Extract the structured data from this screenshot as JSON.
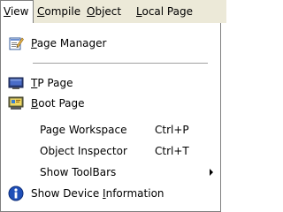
{
  "menubar": {
    "items": [
      {
        "before": "",
        "mnemonic": "V",
        "after": "iew"
      },
      {
        "before": "",
        "mnemonic": "C",
        "after": "ompile"
      },
      {
        "before": "",
        "mnemonic": "O",
        "after": "bject"
      },
      {
        "before": "",
        "mnemonic": "L",
        "after": "ocal Page"
      }
    ]
  },
  "menu": {
    "page_manager": {
      "before": "",
      "mnemonic": "P",
      "after": "age Manager",
      "icon": "page-manager-icon"
    },
    "tp_page": {
      "before": "",
      "mnemonic": "T",
      "after": "P Page",
      "icon": "tp-page-icon"
    },
    "boot_page": {
      "before": "",
      "mnemonic": "B",
      "after": "oot Page",
      "icon": "boot-page-icon"
    },
    "page_workspace": {
      "label": "Page Workspace",
      "shortcut": "Ctrl+P"
    },
    "object_inspector": {
      "label": "Object Inspector",
      "shortcut": "Ctrl+T"
    },
    "show_toolbars": {
      "label": "Show ToolBars"
    },
    "show_device_info": {
      "before": "Show Device ",
      "mnemonic": "I",
      "after": "nformation",
      "icon": "info-icon"
    }
  },
  "colors": {
    "menubar_bg": "#ece9d8",
    "menu_bg": "#ffffff",
    "border": "#808080"
  }
}
